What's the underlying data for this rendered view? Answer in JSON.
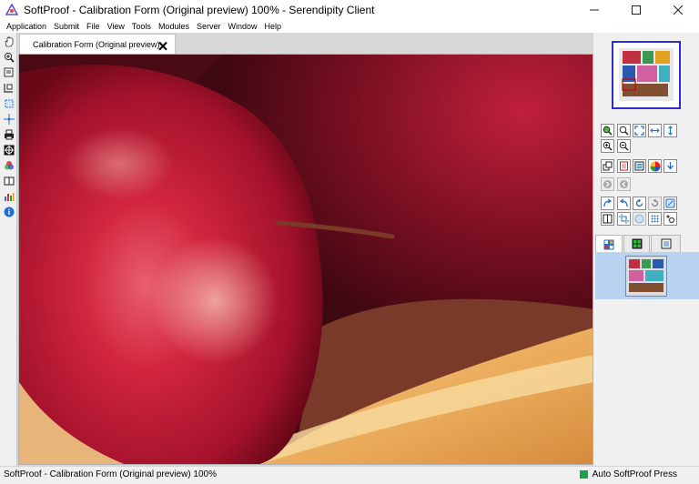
{
  "window": {
    "title": "SoftProof - Calibration Form (Original preview) 100% - Serendipity Client",
    "minimize_icon": "minimize-icon",
    "maximize_icon": "maximize-icon",
    "close_icon": "close-icon"
  },
  "menu": {
    "items": [
      "Application",
      "Submit",
      "File",
      "View",
      "Tools",
      "Modules",
      "Server",
      "Window",
      "Help"
    ]
  },
  "document_tab": {
    "label": "Calibration Form (Original preview)",
    "close_glyph": "🗙"
  },
  "left_toolbar": {
    "tools": [
      "hand-icon",
      "zoom-in-icon",
      "page-icon",
      "crop-icon",
      "select-area-icon",
      "crosshair-icon",
      "print-icon",
      "target-icon",
      "color-wheel-icon",
      "book-icon",
      "histogram-icon",
      "info-icon"
    ]
  },
  "right_toolbar": {
    "rows": [
      [
        "zoom-tool-icon",
        "zoom-box-icon",
        "fit-page-icon",
        "fit-width-icon",
        "fit-height-icon"
      ],
      [
        "zoom-in-icon",
        "zoom-out-icon"
      ],
      [
        "layers-icon",
        "proof-icon",
        "list-icon",
        "color-separation-icon",
        "download-icon"
      ],
      [
        "forward-icon",
        "back-icon"
      ],
      [
        "redo-icon",
        "undo-icon",
        "rotate-cw-icon",
        "rotate-ccw-icon",
        "fullscreen-icon"
      ],
      [
        "split-icon",
        "crop-marks-icon",
        "grid-icon",
        "dots-icon",
        "settings-icon"
      ]
    ],
    "panel_tabs": [
      "thumbnails-icon",
      "color-swatch-icon",
      "info-panel-icon"
    ]
  },
  "status": {
    "left": "SoftProof - Calibration Form (Original preview) 100%",
    "right": "Auto SoftProof Press",
    "indicator_color": "#1aa34a"
  },
  "colors": {
    "accent": "#2d2dcf",
    "selection": "#b8d4f0"
  }
}
